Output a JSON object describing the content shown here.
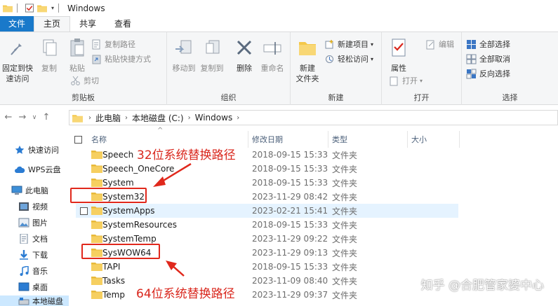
{
  "window": {
    "title": "Windows"
  },
  "tabs": [
    {
      "label": "文件"
    },
    {
      "label": "主页"
    },
    {
      "label": "共享"
    },
    {
      "label": "查看"
    }
  ],
  "ribbon": {
    "clipboard": {
      "label": "剪贴板",
      "pin": "固定到快速访问",
      "pin_l1": "固定到快",
      "pin_l2": "速访问",
      "copy": "复制",
      "paste": "粘贴",
      "copy_path": "复制路径",
      "paste_shortcut": "粘贴快捷方式",
      "cut": "剪切"
    },
    "organize": {
      "label": "组织",
      "move_to": "移动到",
      "copy_to": "复制到",
      "delete": "删除",
      "rename": "重命名"
    },
    "new": {
      "label": "新建",
      "new_folder_l1": "新建",
      "new_folder_l2": "文件夹",
      "new_item": "新建项目",
      "easy_access": "轻松访问"
    },
    "open": {
      "label": "打开",
      "properties": "属性",
      "open": "打开",
      "edit": "编辑"
    },
    "select": {
      "label": "选择",
      "select_all": "全部选择",
      "select_none": "全部取消",
      "invert": "反向选择"
    }
  },
  "address": {
    "crumbs": [
      "此电脑",
      "本地磁盘 (C:)",
      "Windows"
    ]
  },
  "columns": {
    "name": "名称",
    "date": "修改日期",
    "type": "类型",
    "size": "大小"
  },
  "nav": [
    {
      "label": "快速访问",
      "icon": "star-icon"
    },
    {
      "label": "WPS云盘",
      "icon": "cloud-icon"
    },
    {
      "label": "此电脑",
      "icon": "computer-icon"
    },
    {
      "label": "视频",
      "icon": "video-icon"
    },
    {
      "label": "图片",
      "icon": "picture-icon"
    },
    {
      "label": "文档",
      "icon": "document-icon"
    },
    {
      "label": "下载",
      "icon": "download-icon"
    },
    {
      "label": "音乐",
      "icon": "music-icon"
    },
    {
      "label": "桌面",
      "icon": "desktop-icon"
    },
    {
      "label": "本地磁盘",
      "icon": "drive-icon"
    }
  ],
  "files": [
    {
      "name": "Speech",
      "date": "2018-09-15 15:33",
      "type": "文件夹"
    },
    {
      "name": "Speech_OneCore",
      "date": "2018-09-15 15:33",
      "type": "文件夹"
    },
    {
      "name": "System",
      "date": "2018-09-15 15:33",
      "type": "文件夹"
    },
    {
      "name": "System32",
      "date": "2023-11-29 08:42",
      "type": "文件夹"
    },
    {
      "name": "SystemApps",
      "date": "2023-02-21 15:41",
      "type": "文件夹"
    },
    {
      "name": "SystemResources",
      "date": "2018-09-15 15:33",
      "type": "文件夹"
    },
    {
      "name": "SystemTemp",
      "date": "2023-11-29 09:22",
      "type": "文件夹"
    },
    {
      "name": "SysWOW64",
      "date": "2023-11-29 09:13",
      "type": "文件夹"
    },
    {
      "name": "TAPI",
      "date": "2018-09-15 15:33",
      "type": "文件夹"
    },
    {
      "name": "Tasks",
      "date": "2023-11-09 08:40",
      "type": "文件夹"
    },
    {
      "name": "Temp",
      "date": "2023-11-29 09:37",
      "type": "文件夹"
    }
  ],
  "annotations": {
    "top": "32位系统替换路径",
    "bottom": "64位系统替换路径"
  },
  "watermark": "知乎 @合肥管家婆中心",
  "colors": {
    "accent": "#1979ca",
    "annotation": "#e0281c",
    "folder": "#f4c84a"
  }
}
